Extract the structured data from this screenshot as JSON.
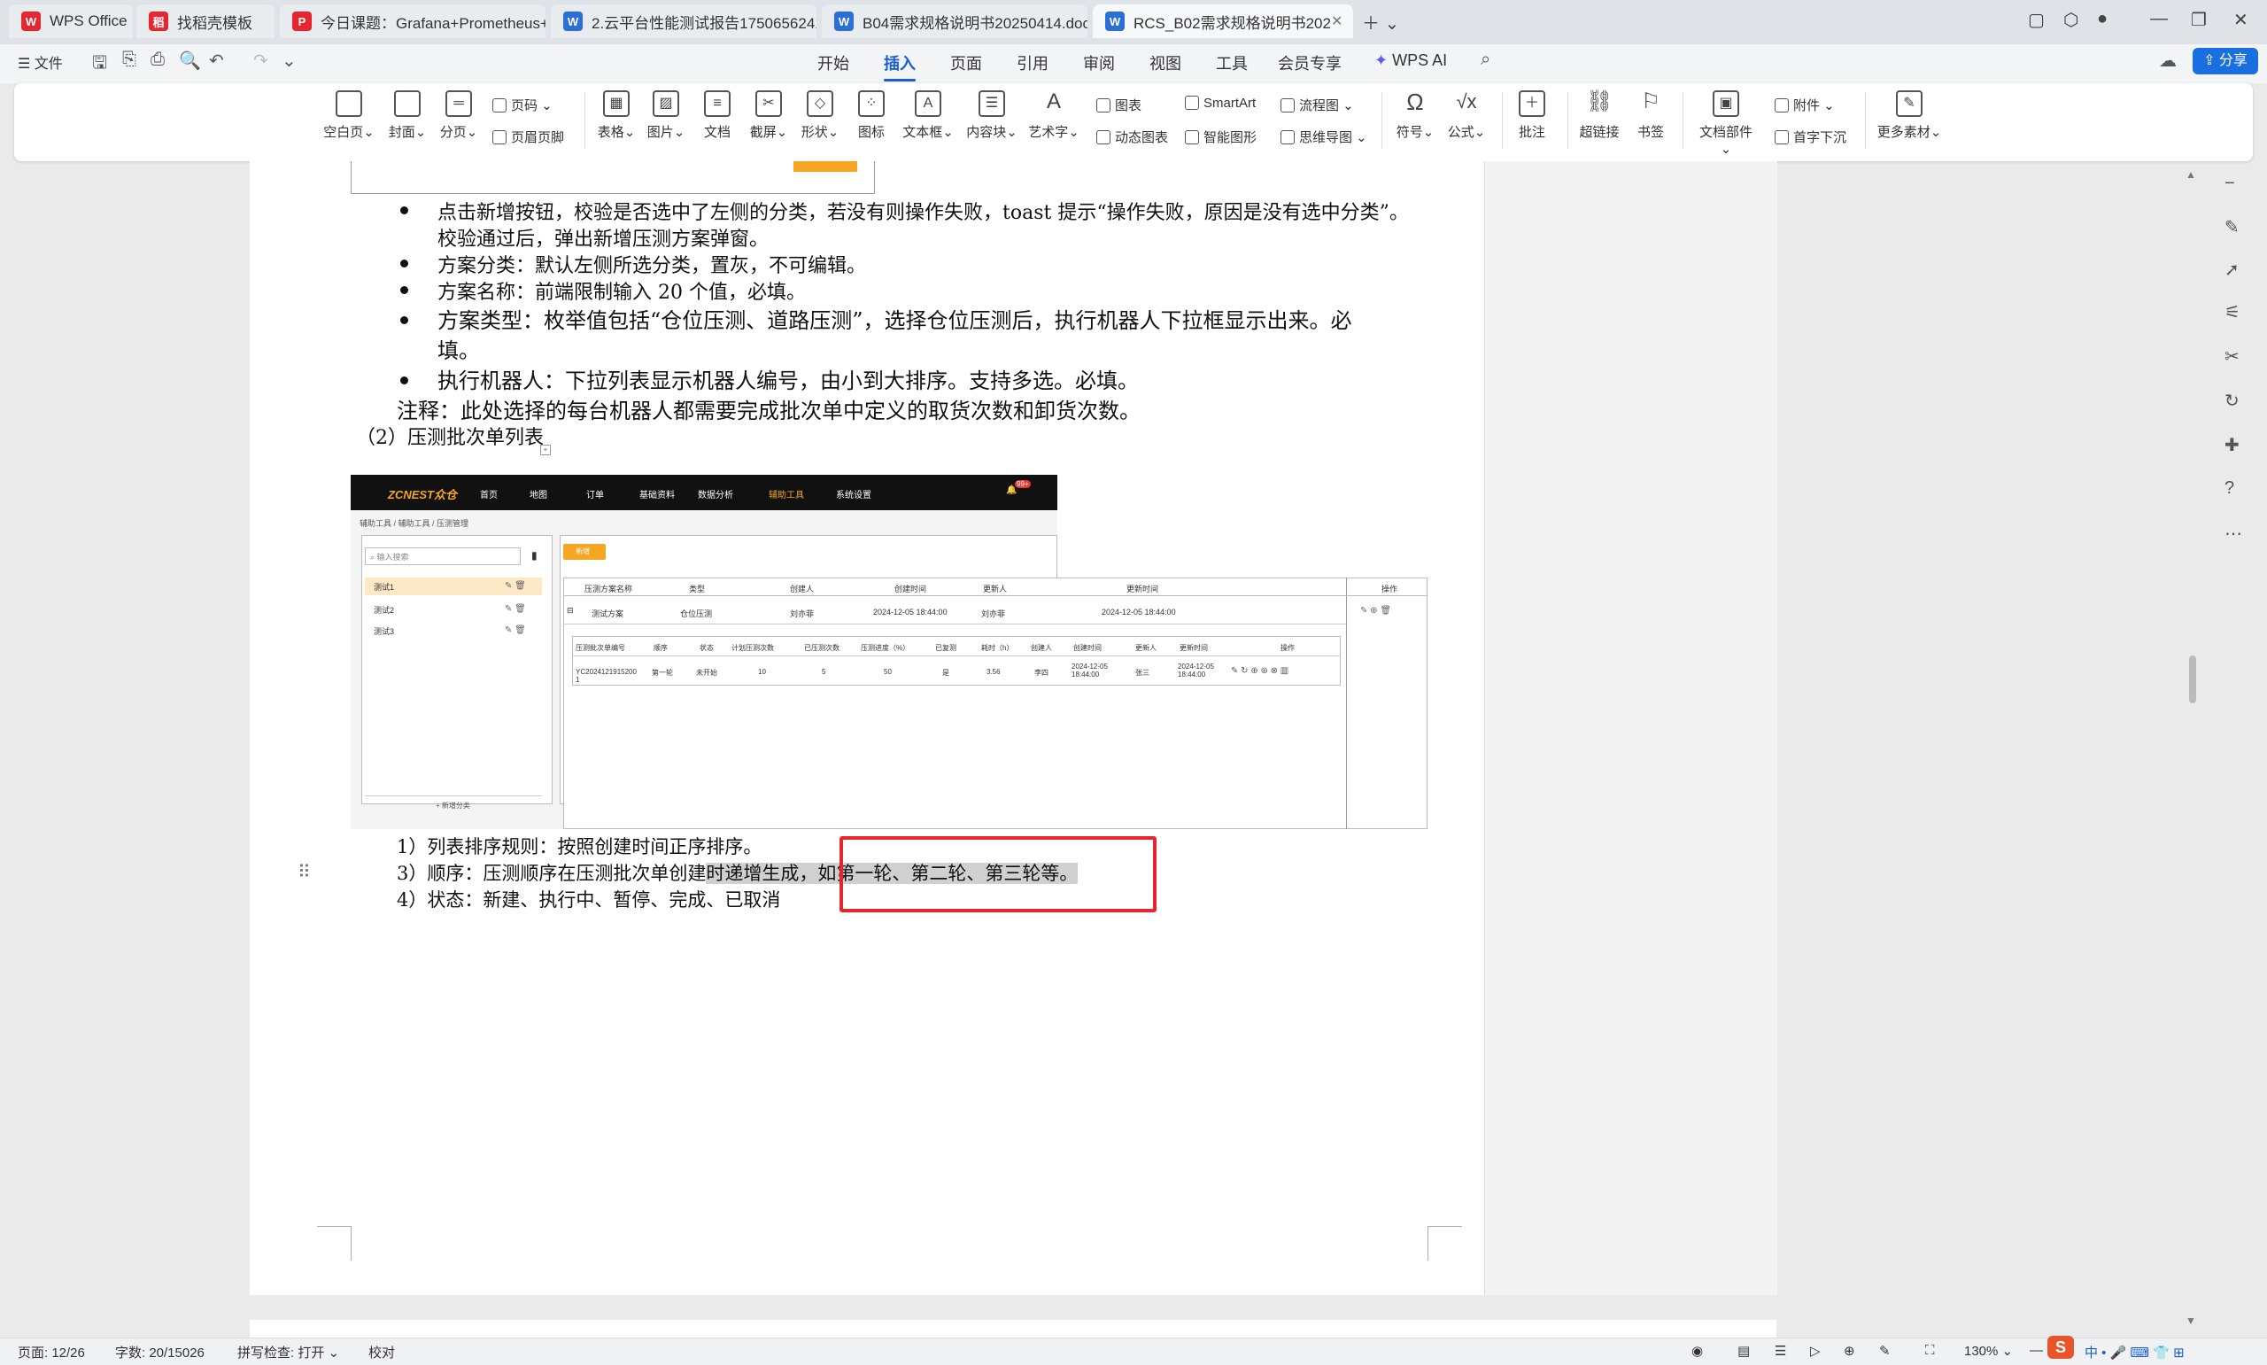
{
  "tabs": [
    {
      "label": "WPS Office",
      "icon": "wps-logo-icon",
      "color": "#e6262f"
    },
    {
      "label": "找稻壳模板",
      "icon": "docer-icon",
      "color": "#e6262f"
    },
    {
      "label": "今日课题：Grafana+Prometheus+l",
      "icon": "pdf-icon",
      "color": "#e6262f"
    },
    {
      "label": "2.云平台性能测试报告1750656241",
      "icon": "word-icon",
      "color": "#2b6fd8"
    },
    {
      "label": "B04需求规格说明书20250414.docx",
      "icon": "word-icon",
      "color": "#2b6fd8"
    },
    {
      "label": "RCS_B02需求规格说明书202",
      "icon": "word-icon",
      "color": "#2b6fd8"
    }
  ],
  "menu": {
    "file": "文件",
    "items": [
      "开始",
      "插入",
      "页面",
      "引用",
      "审阅",
      "视图",
      "工具",
      "会员专享"
    ],
    "active": "插入",
    "ai": "WPS AI",
    "share": "分享"
  },
  "ribbon": {
    "big": [
      "空白页",
      "封面",
      "分页",
      "表格",
      "图片",
      "文档",
      "截屏",
      "形状",
      "图标",
      "文本框",
      "内容块",
      "艺术字",
      "符号",
      "公式",
      "批注",
      "超链接",
      "书签",
      "文档部件",
      "更多素材"
    ],
    "small": {
      "page_num": "页码",
      "header_footer": "页眉页脚",
      "chart": "图表",
      "dyn_chart": "动态图表",
      "smartart": "SmartArt",
      "smart_shape": "智能图形",
      "flowchart": "流程图",
      "mindmap": "思维导图",
      "attach": "附件",
      "dropcap": "首字下沉"
    }
  },
  "doc": {
    "b1a": "点击新增按钮，校验是否选中了左侧的分类，若没有则操作失败，toast 提示“操作失败，原因是没有选中分类”。",
    "b1b": "校验通过后，弹出新增压测方案弹窗。",
    "b2": "方案分类：默认左侧所选分类，置灰，不可编辑。",
    "b3": "方案名称：前端限制输入 20 个值，必填。",
    "b4a": "方案类型：枚举值包括“仓位压测、道路压测”，选择仓位压测后，执行机器人下拉框显示出来。必",
    "b4b": "填。",
    "b5": "执行机器人：下拉列表显示机器人编号，由小到大排序。支持多选。必填。",
    "note": "注释：此处选择的每台机器人都需要完成批次单中定义的取货次数和卸货次数。",
    "section": "（2）压测批次单列表",
    "l1": "1）列表排序规则：按照创建时间正序排序。",
    "l2_pre": "3）顺序：压测顺序在压测批次单创建",
    "l2_hl": "时递增生成，如第一轮、第二轮、第三轮等。",
    "l3": "4）状态：新建、执行中、暂停、完成、已取消"
  },
  "shot": {
    "logo": "ZCNEST众仓",
    "nav": [
      "首页",
      "地图",
      "订单",
      "基础资料",
      "数据分析",
      "辅助工具",
      "系统设置"
    ],
    "badge": "99+",
    "crumb": "辅助工具 / 辅助工具 / 压测管理",
    "search": "输入搜索",
    "add": "新增",
    "cats": [
      "测试1",
      "测试2",
      "测试3"
    ],
    "add_cat": "+ 新增分类",
    "headers": [
      "压测方案名称",
      "类型",
      "创建人",
      "创建时间",
      "更新人",
      "更新时间",
      "操作"
    ],
    "row": [
      "测试方案",
      "仓位压测",
      "刘亦菲",
      "2024-12-05 18:44:00",
      "刘亦菲",
      "2024-12-05 18:44:00"
    ],
    "sub_headers": [
      "压测批次单编号",
      "顺序",
      "状态",
      "计划压测次数",
      "已压测次数",
      "压测进度（%）",
      "已复测",
      "耗时（h）",
      "创建人",
      "创建时间",
      "更新人",
      "更新时间",
      "操作"
    ],
    "sub_row": [
      "YC20241219152001",
      "第一轮",
      "未开始",
      "10",
      "5",
      "50",
      "是",
      "3.56",
      "李四",
      "2024-12-05 18:44:00",
      "张三",
      "2024-12-05 18:44:00"
    ]
  },
  "status": {
    "page": "页面: 12/26",
    "words": "字数: 20/15026",
    "spell": "拼写检查: 打开",
    "proof": "校对",
    "zoom": "130%"
  }
}
